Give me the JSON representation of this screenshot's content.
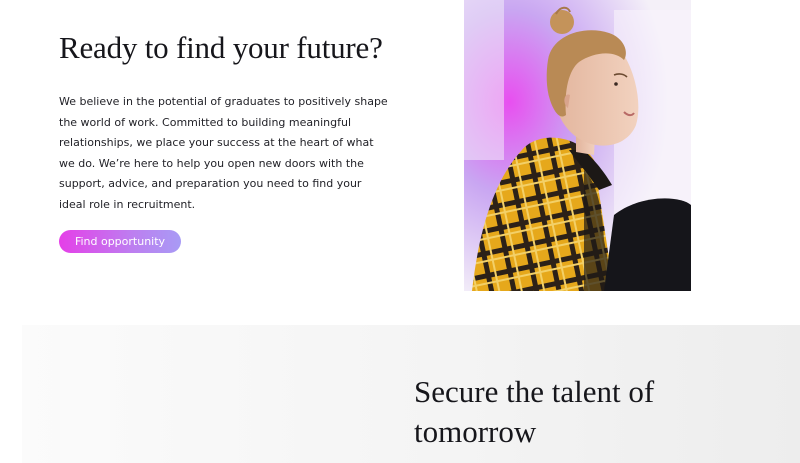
{
  "hero": {
    "heading": "Ready to find your future?",
    "body": "We believe in the potential of graduates to positively shape the world of work. Committed to building meaningful relationships, we place your success at the heart of what we do. We’re here to help you open new doors with the support, advice, and preparation you need to find your ideal role in recruitment.",
    "cta_label": "Find opportunity",
    "cta_gradient": [
      "#e53fe8",
      "#bd7ef0",
      "#a89bf5"
    ]
  },
  "photo": {
    "subject": "young-woman-plaid-jacket-photo",
    "accent_colors": [
      "#d63be6",
      "#e9b01c",
      "#2a2420"
    ]
  },
  "talent_section": {
    "heading": "Secure the talent of tomorrow"
  }
}
